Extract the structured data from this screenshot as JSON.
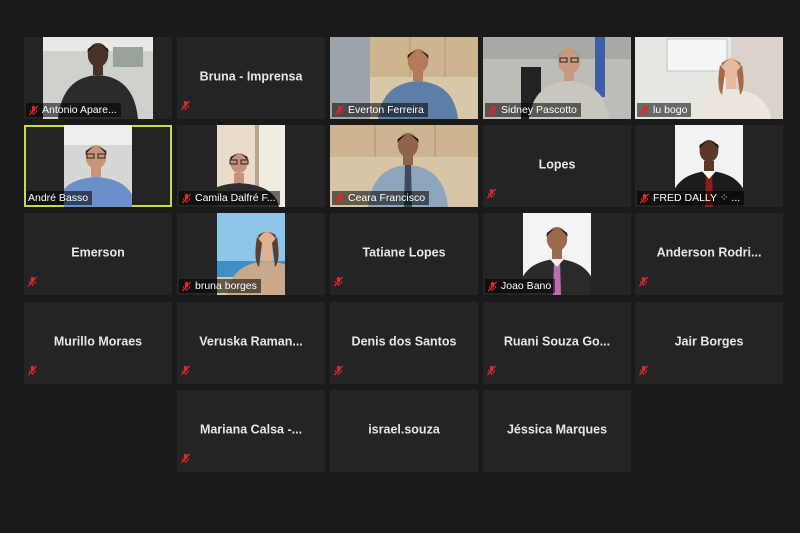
{
  "colors": {
    "background": "#1a1a1a",
    "tile": "#242424",
    "active_speaker_border": "#c8d94c",
    "muted_icon": "#e0262a"
  },
  "participants": [
    {
      "name": "Antonio Apare...",
      "video": true,
      "muted": true,
      "scene": "office-dark"
    },
    {
      "name": "Bruna - Imprensa",
      "video": false,
      "muted": true
    },
    {
      "name": "Everton Ferreira",
      "video": true,
      "muted": true,
      "scene": "kitchen-man"
    },
    {
      "name": "Sidney Pascotto",
      "video": true,
      "muted": true,
      "scene": "office-older-man"
    },
    {
      "name": "lu bogo",
      "video": true,
      "muted": true,
      "scene": "woman-window"
    },
    {
      "name": "André Basso",
      "video": true,
      "muted": false,
      "active": true,
      "scene": "glasses-man"
    },
    {
      "name": "Camila Dalfré F...",
      "video": true,
      "muted": true,
      "scene": "woman-door"
    },
    {
      "name": "Ceara Francisco",
      "video": true,
      "muted": true,
      "scene": "kitchen-man-tie"
    },
    {
      "name": "Lopes",
      "video": false,
      "muted": true
    },
    {
      "name": "FRED DALLY ⁘ ...",
      "video": true,
      "muted": true,
      "scene": "portrait-suit"
    },
    {
      "name": "Emerson",
      "video": false,
      "muted": true
    },
    {
      "name": "bruna borges",
      "video": true,
      "muted": true,
      "scene": "beach-woman"
    },
    {
      "name": "Tatiane Lopes",
      "video": false,
      "muted": true
    },
    {
      "name": "Joao Bano",
      "video": true,
      "muted": true,
      "scene": "portrait-pink-tie"
    },
    {
      "name": "Anderson  Rodri...",
      "video": false,
      "muted": true
    },
    {
      "name": "Murillo Moraes",
      "video": false,
      "muted": true
    },
    {
      "name": "Veruska  Raman...",
      "video": false,
      "muted": true
    },
    {
      "name": "Denis dos Santos",
      "video": false,
      "muted": true
    },
    {
      "name": "Ruani  Souza  Go...",
      "video": false,
      "muted": true
    },
    {
      "name": "Jair Borges",
      "video": false,
      "muted": true
    },
    {
      "name": "Mariana  Calsa  -...",
      "video": false,
      "muted": true
    },
    {
      "name": "israel.souza",
      "video": false,
      "muted": false
    },
    {
      "name": "Jéssica Marques",
      "video": false,
      "muted": false
    }
  ]
}
